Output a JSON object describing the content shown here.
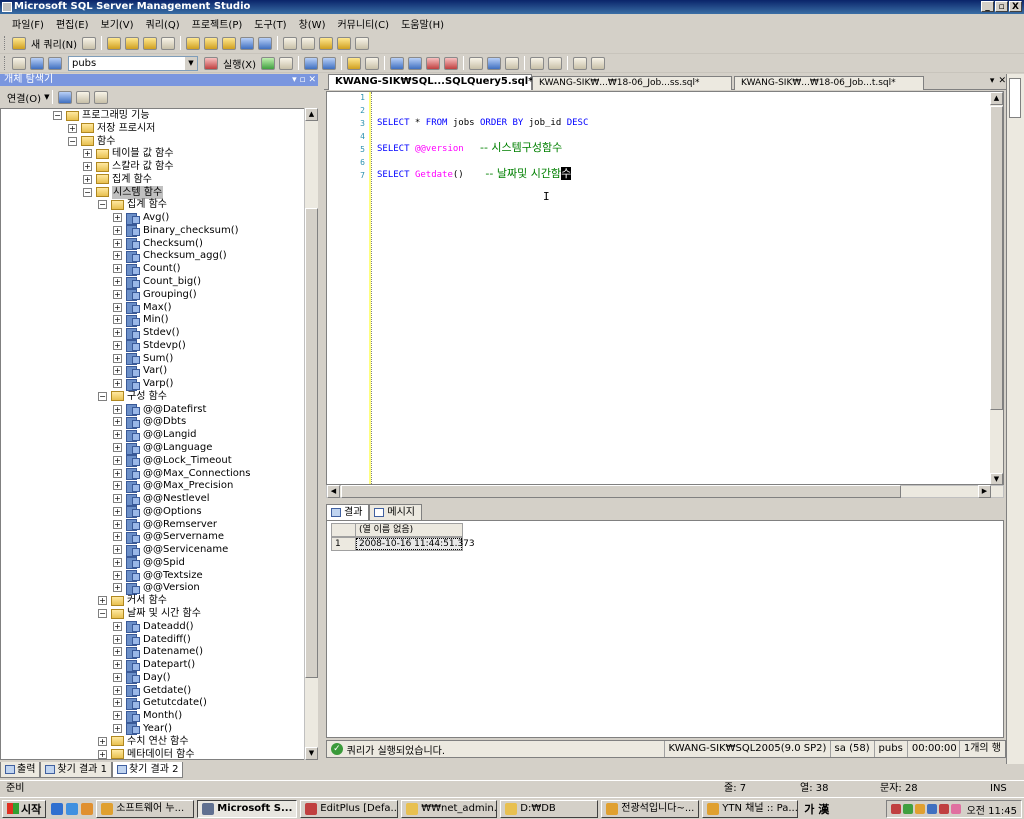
{
  "window": {
    "title": "Microsoft SQL Server Management Studio",
    "controls": [
      "_",
      "▫",
      "X"
    ]
  },
  "menu": [
    "파일(F)",
    "편집(E)",
    "보기(V)",
    "쿼리(Q)",
    "프로젝트(P)",
    "도구(T)",
    "창(W)",
    "커뮤니티(C)",
    "도움말(H)"
  ],
  "toolbar1": {
    "new_query_label": "새 쿼리(N)"
  },
  "toolbar2": {
    "database": "pubs",
    "execute_label": "실행(X)"
  },
  "object_explorer": {
    "title": "개체 탐색기",
    "connect_label": "연결(O)",
    "tree": [
      {
        "label": "프로그래밍 기능",
        "kind": "folder",
        "level": 0,
        "expanded": true
      },
      {
        "label": "저장 프로시저",
        "kind": "folder",
        "level": 1,
        "expanded": false
      },
      {
        "label": "함수",
        "kind": "folder",
        "level": 1,
        "expanded": true
      },
      {
        "label": "테이블 값 함수",
        "kind": "folder",
        "level": 2,
        "expanded": false
      },
      {
        "label": "스칼라 값 함수",
        "kind": "folder",
        "level": 2,
        "expanded": false
      },
      {
        "label": "집계 함수",
        "kind": "folder",
        "level": 2,
        "expanded": false
      },
      {
        "label": "시스템 함수",
        "kind": "folder",
        "level": 2,
        "expanded": true,
        "selected": true
      },
      {
        "label": "집계 함수",
        "kind": "folder",
        "level": 3,
        "expanded": true
      },
      {
        "label": "Avg()",
        "kind": "func",
        "level": 4
      },
      {
        "label": "Binary_checksum()",
        "kind": "func",
        "level": 4
      },
      {
        "label": "Checksum()",
        "kind": "func",
        "level": 4
      },
      {
        "label": "Checksum_agg()",
        "kind": "func",
        "level": 4
      },
      {
        "label": "Count()",
        "kind": "func",
        "level": 4
      },
      {
        "label": "Count_big()",
        "kind": "func",
        "level": 4
      },
      {
        "label": "Grouping()",
        "kind": "func",
        "level": 4
      },
      {
        "label": "Max()",
        "kind": "func",
        "level": 4
      },
      {
        "label": "Min()",
        "kind": "func",
        "level": 4
      },
      {
        "label": "Stdev()",
        "kind": "func",
        "level": 4
      },
      {
        "label": "Stdevp()",
        "kind": "func",
        "level": 4
      },
      {
        "label": "Sum()",
        "kind": "func",
        "level": 4
      },
      {
        "label": "Var()",
        "kind": "func",
        "level": 4
      },
      {
        "label": "Varp()",
        "kind": "func",
        "level": 4
      },
      {
        "label": "구성 함수",
        "kind": "folder",
        "level": 3,
        "expanded": true
      },
      {
        "label": "@@Datefirst",
        "kind": "func",
        "level": 4
      },
      {
        "label": "@@Dbts",
        "kind": "func",
        "level": 4
      },
      {
        "label": "@@Langid",
        "kind": "func",
        "level": 4
      },
      {
        "label": "@@Language",
        "kind": "func",
        "level": 4
      },
      {
        "label": "@@Lock_Timeout",
        "kind": "func",
        "level": 4
      },
      {
        "label": "@@Max_Connections",
        "kind": "func",
        "level": 4
      },
      {
        "label": "@@Max_Precision",
        "kind": "func",
        "level": 4
      },
      {
        "label": "@@Nestlevel",
        "kind": "func",
        "level": 4
      },
      {
        "label": "@@Options",
        "kind": "func",
        "level": 4
      },
      {
        "label": "@@Remserver",
        "kind": "func",
        "level": 4
      },
      {
        "label": "@@Servername",
        "kind": "func",
        "level": 4
      },
      {
        "label": "@@Servicename",
        "kind": "func",
        "level": 4
      },
      {
        "label": "@@Spid",
        "kind": "func",
        "level": 4
      },
      {
        "label": "@@Textsize",
        "kind": "func",
        "level": 4
      },
      {
        "label": "@@Version",
        "kind": "func",
        "level": 4
      },
      {
        "label": "커서 함수",
        "kind": "folder",
        "level": 3,
        "expanded": false
      },
      {
        "label": "날짜 및 시간 함수",
        "kind": "folder",
        "level": 3,
        "expanded": true
      },
      {
        "label": "Dateadd()",
        "kind": "func",
        "level": 4
      },
      {
        "label": "Datediff()",
        "kind": "func",
        "level": 4
      },
      {
        "label": "Datename()",
        "kind": "func",
        "level": 4
      },
      {
        "label": "Datepart()",
        "kind": "func",
        "level": 4
      },
      {
        "label": "Day()",
        "kind": "func",
        "level": 4
      },
      {
        "label": "Getdate()",
        "kind": "func",
        "level": 4
      },
      {
        "label": "Getutcdate()",
        "kind": "func",
        "level": 4
      },
      {
        "label": "Month()",
        "kind": "func",
        "level": 4
      },
      {
        "label": "Year()",
        "kind": "func",
        "level": 4
      },
      {
        "label": "수치 연산 함수",
        "kind": "folder",
        "level": 3,
        "expanded": false
      },
      {
        "label": "메타데이터 함수",
        "kind": "folder",
        "level": 3,
        "expanded": false
      }
    ]
  },
  "doc_tabs": [
    {
      "label": "KWANG-SIK₩SQL...SQLQuery5.sql*",
      "active": true
    },
    {
      "label": "KWANG-SIK₩...₩18-06_Job...ss.sql*",
      "active": false
    },
    {
      "label": "KWANG-SIK₩...₩18-06_Job...t.sql*",
      "active": false
    }
  ],
  "tab_controls": [
    "▾",
    "✕"
  ],
  "editor": {
    "line_numbers": [
      "1",
      "2",
      "3",
      "4",
      "5",
      "6",
      "7"
    ],
    "line3": {
      "k1": "SELECT",
      "t1": " * ",
      "k2": "FROM",
      "t2": " jobs ",
      "k3": "ORDER BY",
      "t3": " job_id ",
      "k4": "DESC"
    },
    "line5": {
      "k1": "SELECT",
      "f1": "@@version",
      "c1": "-- 시스템구성함수"
    },
    "line7": {
      "k1": "SELECT",
      "f1": "Getdate",
      "p1": "()",
      "c1": "-- 날짜및 시간함",
      "cursor": "수"
    }
  },
  "results_tabs": [
    "결과",
    "메시지"
  ],
  "results": {
    "header": "(열 이름 없음)",
    "rows": [
      {
        "num": "1",
        "value": "2008-10-16 11:44:51.373"
      }
    ]
  },
  "query_status": {
    "message": "쿼리가 실행되었습니다.",
    "server": "KWANG-SIK₩SQL2005(9.0 SP2)",
    "user": "sa (58)",
    "db": "pubs",
    "time": "00:00:00",
    "rows": "1개의 행"
  },
  "bottom_tabs": [
    "출력",
    "찾기 결과 1",
    "찾기 결과 2"
  ],
  "app_status": {
    "state": "준비",
    "line": "줄: 7",
    "col": "열: 38",
    "ch": "문자: 28",
    "mode": "INS"
  },
  "taskbar": {
    "start": "시작",
    "tasks": [
      "소프트웨어 누...",
      "Microsoft S...",
      "EditPlus [Defa...",
      "₩₩net_admin...",
      "D:₩DB",
      "전광석입니다~...",
      "YTN 채널 :: Pa..."
    ],
    "ime": "가 漢",
    "clock": "오전 11:45"
  }
}
